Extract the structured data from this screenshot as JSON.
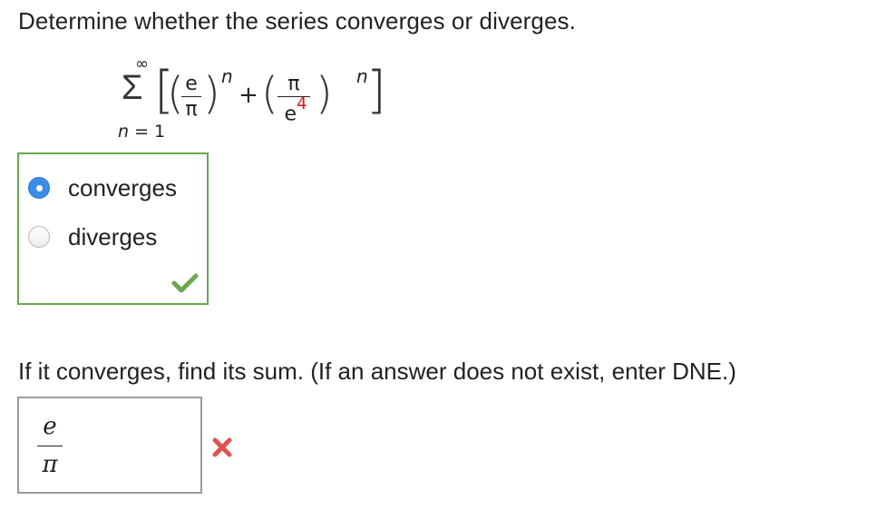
{
  "question": {
    "prompt": "Determine whether the series converges or diverges."
  },
  "series": {
    "sigma": "Σ",
    "upper_limit": "∞",
    "lower_var": "n",
    "lower_eq": "= 1",
    "bracket_open": "[",
    "bracket_close": "]",
    "paren_open": "(",
    "paren_close": ")",
    "term1": {
      "numerator": "e",
      "denominator": "π",
      "exponent": "n"
    },
    "plus": "+",
    "term2": {
      "numerator": "π",
      "denominator_base": "e",
      "denominator_power": "4",
      "exponent": "n"
    }
  },
  "choices": {
    "options": [
      {
        "label": "converges",
        "selected": true
      },
      {
        "label": "diverges",
        "selected": false
      }
    ],
    "status_color": "#6aa84f",
    "status_icon": "check-mark-icon"
  },
  "sum_question": {
    "prompt": "If it converges, find its sum. (If an answer does not exist, enter DNE.)"
  },
  "answer": {
    "numerator": "e",
    "denominator": "π",
    "status_icon": "x-mark-icon",
    "status_color": "#e05252"
  },
  "colors": {
    "accent": "#3b8ce8",
    "highlight": "#e0161b"
  }
}
